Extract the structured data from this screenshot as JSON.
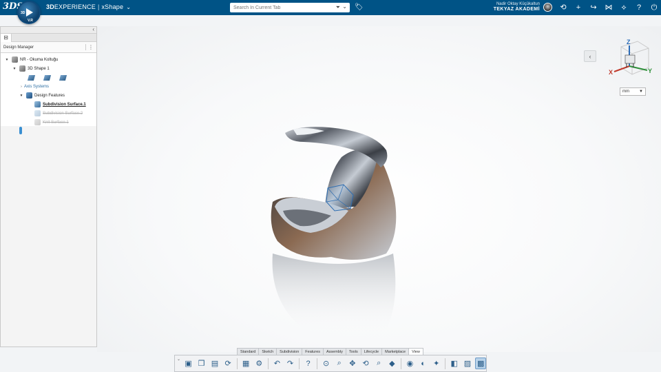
{
  "topbar": {
    "logo": "3DS",
    "brand_bold": "3D",
    "brand_rest": "EXPERIENCE",
    "separator": "|",
    "app_name": "xShape",
    "search_placeholder": "Search In Current Tab",
    "user_name": "Nadir Oktay Küçükaltun",
    "company": "TEKYAZ AKADEMİ",
    "compass_quadrants": [
      "3D",
      "V.R"
    ],
    "icons": [
      "share-icon",
      "add-icon",
      "share-arrow-icon",
      "community-icon",
      "apps-icon",
      "help-icon",
      "power-icon"
    ]
  },
  "panel": {
    "title": "Design Manager",
    "tree": {
      "root": "NR - Okuma Koltuğu",
      "shape": "3D Shape 1",
      "axis": "Axis Systems",
      "design_features": "Design Features",
      "features": [
        {
          "label": "Subdivision Surface.1",
          "state": "active"
        },
        {
          "label": "Subdivision Surface.2",
          "state": "deactivated"
        },
        {
          "label": "Knit Surface.1",
          "state": "deactivated"
        }
      ]
    }
  },
  "viewport": {
    "units": "mm",
    "compass_axes": [
      "Z",
      "X",
      "Y"
    ],
    "model_colors": {
      "metal_dark": "#4a4f58",
      "metal_light": "#d8dde3",
      "bronze": "#8b6a52"
    }
  },
  "actionbar": {
    "tabs": [
      "Standard",
      "Sketch",
      "Subdivision",
      "Features",
      "Assembly",
      "Tools",
      "Lifecycle",
      "Marketplace",
      "View"
    ],
    "active_tab": "View"
  }
}
